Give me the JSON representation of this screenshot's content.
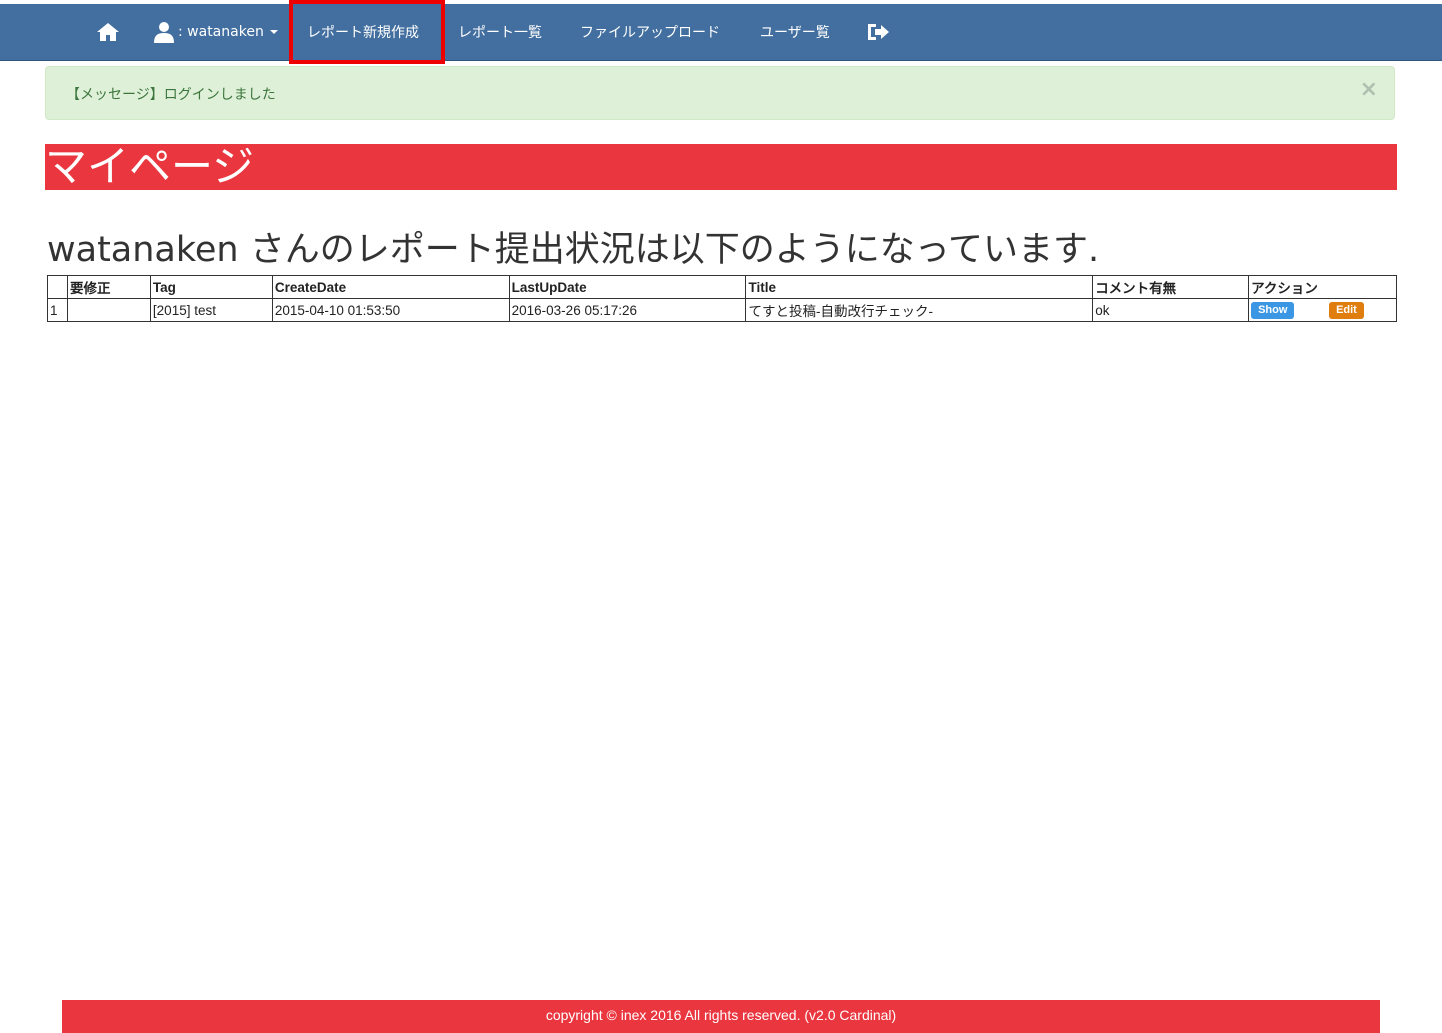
{
  "nav": {
    "home_icon": "home-icon",
    "user_icon": "user-icon",
    "user_label": ": watanaken",
    "items": [
      {
        "label": "レポート新規作成"
      },
      {
        "label": "レポート一覧"
      },
      {
        "label": "ファイルアップロード"
      },
      {
        "label": "ユーザー覧"
      }
    ],
    "logout_icon": "sign-out-icon",
    "highlight_color": "#ef0000",
    "bar_color": "#426f9f"
  },
  "alert": {
    "message": "【メッセージ】ログインしました",
    "close": "×"
  },
  "page_title": "マイページ",
  "status_heading": "watanaken さんのレポート提出状況は以下のようになっています.",
  "table": {
    "headers": [
      "",
      "要修正",
      "Tag",
      "CreateDate",
      "LastUpDate",
      "Title",
      "コメント有無",
      "アクション"
    ],
    "rows": [
      {
        "no": "1",
        "fix": "",
        "tag": "[2015] test",
        "create_date": "2015-04-10 01:53:50",
        "last_update": "2016-03-26 05:17:26",
        "title": "てすと投稿-自動改行チェック-",
        "comment": "ok",
        "show_label": "Show",
        "edit_label": "Edit"
      }
    ]
  },
  "footer": "copyright © inex 2016 All rights reserved. (v2.0 Cardinal)",
  "colors": {
    "accent_red": "#e9363f",
    "alert_bg": "#dff0d8",
    "show_button": "#3b97e3",
    "edit_button": "#df7d0e"
  }
}
